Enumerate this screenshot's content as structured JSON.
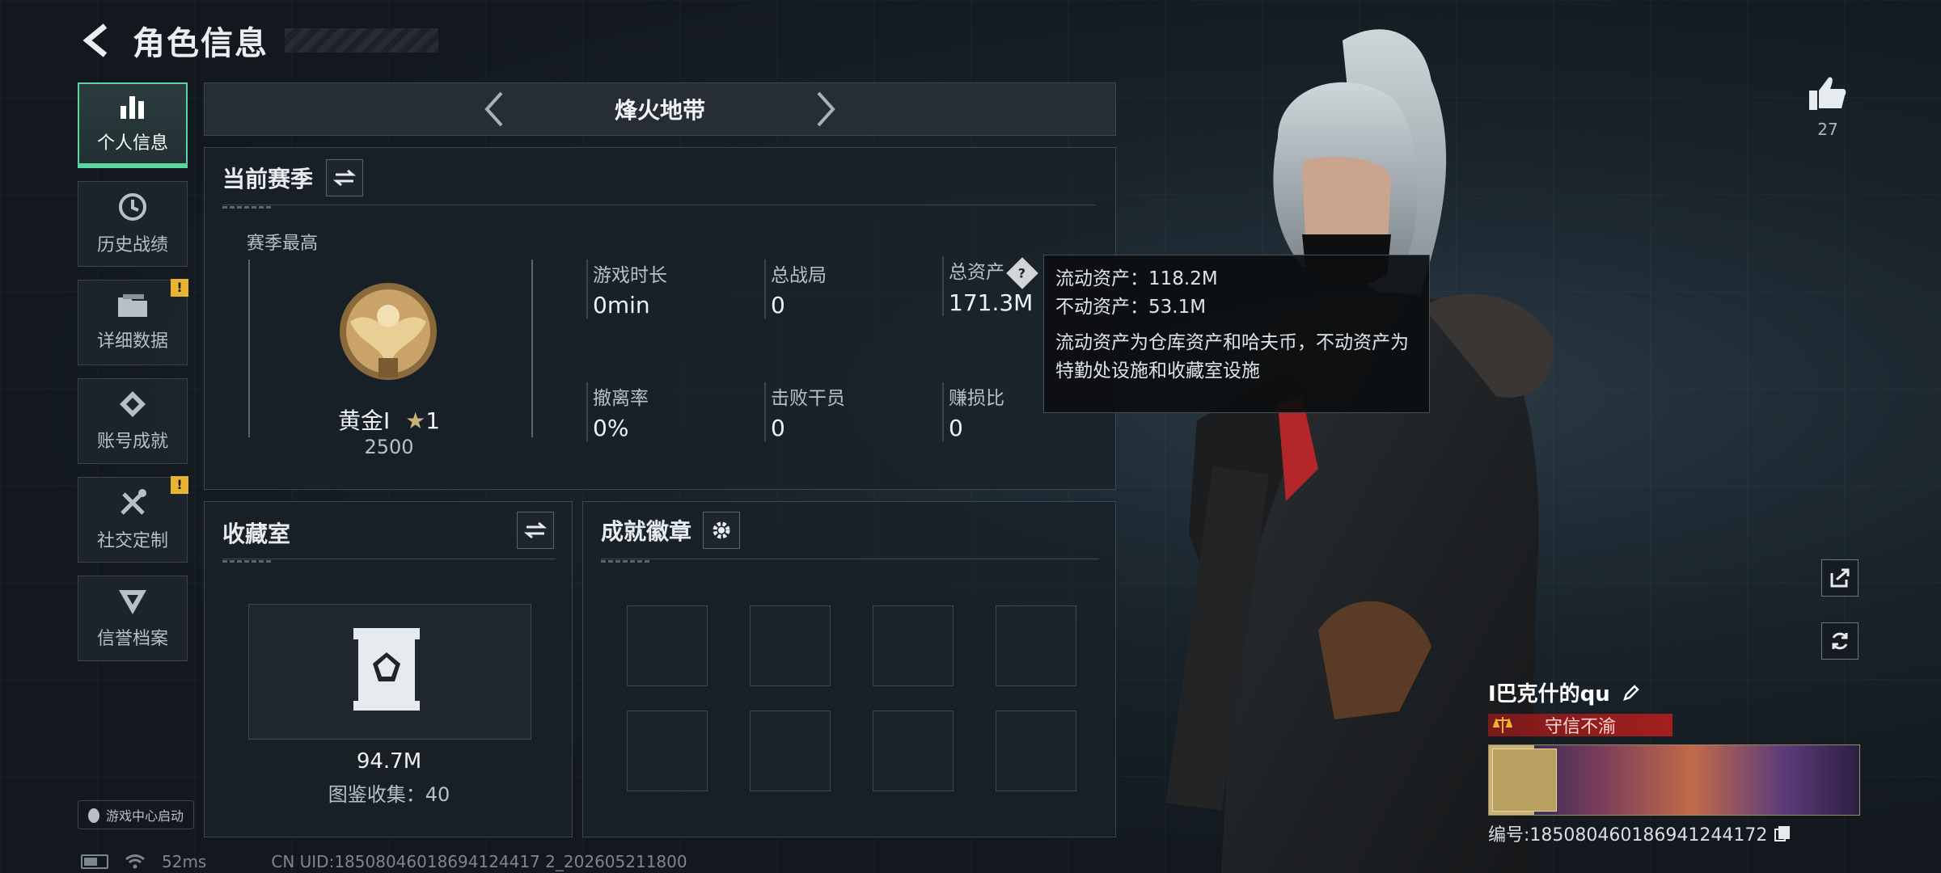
{
  "header": {
    "title": "角色信息"
  },
  "sidebar": {
    "items": [
      {
        "label": "个人信息",
        "icon": "bar-chart-icon",
        "active": true
      },
      {
        "label": "历史战绩",
        "icon": "clock-icon"
      },
      {
        "label": "详细数据",
        "icon": "folder-icon",
        "badge": "!"
      },
      {
        "label": "账号成就",
        "icon": "medal-icon"
      },
      {
        "label": "社交定制",
        "icon": "tools-icon",
        "badge": "!"
      },
      {
        "label": "信誉档案",
        "icon": "shield-icon"
      }
    ],
    "game_center": "游戏中心启动"
  },
  "season_bar": {
    "mode": "烽火地带"
  },
  "current_season": {
    "title": "当前赛季",
    "best_label": "赛季最高",
    "rank_name": "黄金I",
    "stars": "1",
    "rank_score": "2500",
    "stats": [
      {
        "label": "游戏时长",
        "value": "0min"
      },
      {
        "label": "总战局",
        "value": "0"
      },
      {
        "label": "总资产",
        "value": "171.3M"
      },
      {
        "label": "撤离率",
        "value": "0%"
      },
      {
        "label": "击败干员",
        "value": "0"
      },
      {
        "label": "赚损比",
        "value": "0"
      }
    ]
  },
  "tooltip": {
    "line1": "流动资产：118.2M",
    "line2": "不动资产：53.1M",
    "desc": "流动资产为仓库资产和哈夫币，不动资产为特勤处设施和收藏室设施"
  },
  "collection": {
    "title": "收藏室",
    "value": "94.7M",
    "count_text": "图鉴收集：40"
  },
  "achievements": {
    "title": "成就徽章"
  },
  "player": {
    "likes": "27",
    "name": "I巴克什的qu",
    "title_badge": "守信不渝",
    "id_text": "编号:18508046018694124417​2"
  },
  "status": {
    "ping": "52ms",
    "uid": "CN UID:18508046018694124417 2_202605211800"
  },
  "colors": {
    "accent": "#5bd6a0",
    "warning": "#e9b531",
    "rank_red": "#a31f1f"
  }
}
